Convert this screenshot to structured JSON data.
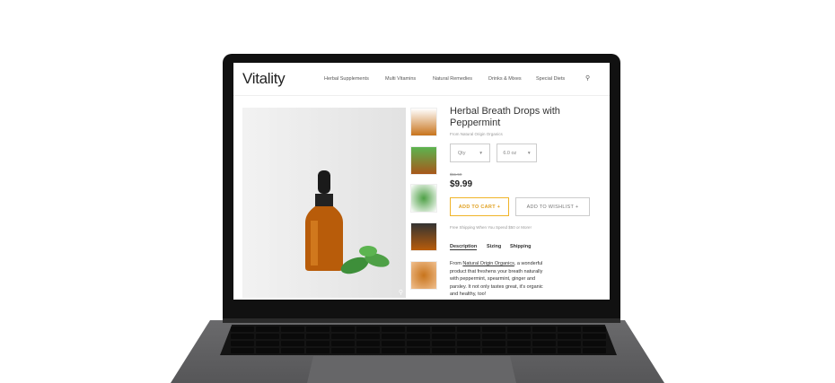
{
  "site": {
    "logo": "Vitality",
    "nav": [
      "Herbal Supplements",
      "Multi Vitamins",
      "Natural Remedies",
      "Drinks & Mixes",
      "Special Diets"
    ]
  },
  "product": {
    "title": "Herbal Breath Drops with Peppermint",
    "brand": "From Natural Origin Organics",
    "qty_label": "Qty",
    "size_label": "6.0 oz",
    "old_price": "$11.50",
    "price": "$9.99",
    "add_to_cart": "ADD TO CART +",
    "add_to_wishlist": "ADD TO WISHLIST +",
    "shipping_note": "Free Shipping When You Spend $50 or More!",
    "tabs": [
      "Description",
      "Sizing",
      "Shipping"
    ],
    "desc_prefix": "From ",
    "desc_link": "Natural Origin Organics",
    "desc_rest": ", a wonderful product that freshens your breath naturally with peppermint, spearmint, ginger and parsley. It not only tastes great, it's organic and healthy, too!"
  },
  "colors": {
    "accent": "#f0b429",
    "bottle": "#b85c0a"
  }
}
